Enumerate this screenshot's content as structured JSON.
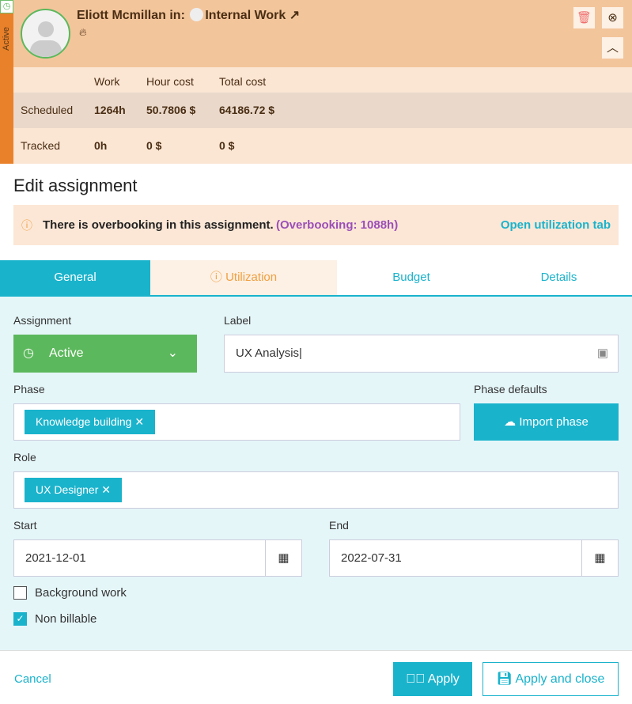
{
  "sidebar": {
    "status": "Active"
  },
  "header": {
    "user": "Eliott Mcmillan in:",
    "project": "Internal Work"
  },
  "stats": {
    "cols": [
      "Work",
      "Hour cost",
      "Total cost"
    ],
    "rows": [
      {
        "label": "Scheduled",
        "work": "1264h",
        "hour_cost": "50.7806 $",
        "total": "64186.72 $"
      },
      {
        "label": "Tracked",
        "work": "0h",
        "hour_cost": "0 $",
        "total": "0 $"
      }
    ]
  },
  "page_title": "Edit assignment",
  "alert": {
    "text": "There is overbooking in this assignment.",
    "detail": "(Overbooking: 1088h)",
    "link": "Open utilization tab"
  },
  "tabs": [
    "General",
    "Utilization",
    "Budget",
    "Details"
  ],
  "form": {
    "assignment_label": "Assignment",
    "assignment_value": "Active",
    "label_label": "Label",
    "label_value": "UX Analysis",
    "phase_label": "Phase",
    "phase_chip": "Knowledge building",
    "phase_defaults_label": "Phase defaults",
    "import_phase": "Import phase",
    "role_label": "Role",
    "role_chip": "UX Designer",
    "start_label": "Start",
    "start_value": "2021-12-01",
    "end_label": "End",
    "end_value": "2022-07-31",
    "background_work": "Background work",
    "non_billable": "Non billable"
  },
  "footer": {
    "cancel": "Cancel",
    "apply": "Apply",
    "apply_close": "Apply and close"
  }
}
